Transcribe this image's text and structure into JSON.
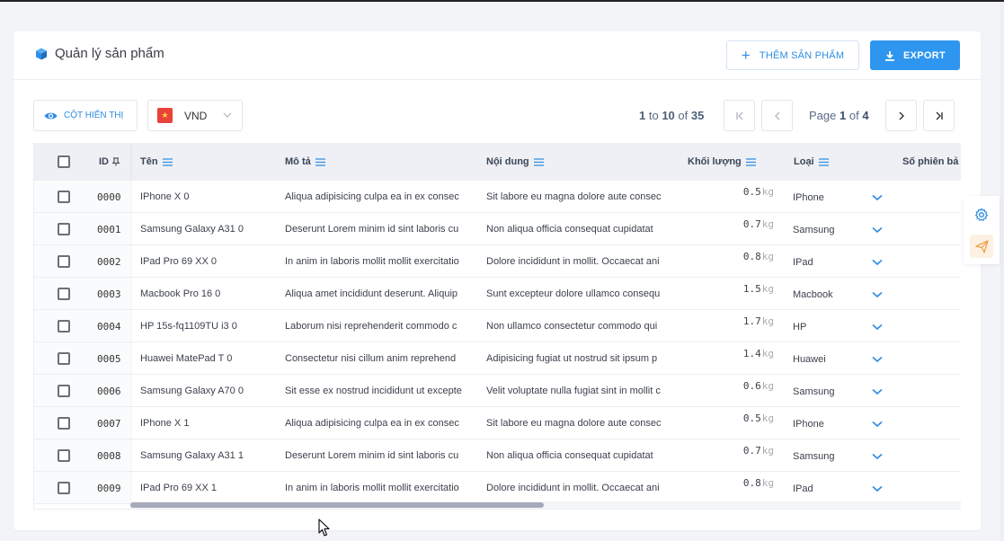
{
  "header": {
    "title": "Quản lý sản phẩm",
    "add_button": "THÊM SẢN PHẨM",
    "export_button": "EXPORT"
  },
  "toolbar": {
    "columns_button": "CỘT HIỂN THỊ",
    "currency": "VND",
    "pagination": {
      "from": "1",
      "to_word": "to",
      "to": "10",
      "of_word": "of",
      "total": "35",
      "page_word": "Page",
      "page": "1",
      "page_of_word": "of",
      "page_total": "4"
    }
  },
  "table": {
    "headers": {
      "id": "ID",
      "name": "Tên",
      "description": "Mô tả",
      "content": "Nội dung",
      "weight": "Khối lượng",
      "type": "Loại",
      "version": "Số phiên bả"
    },
    "weight_unit": "kg",
    "rows": [
      {
        "id": "0000",
        "name": "IPhone X 0",
        "description": "Aliqua adipisicing culpa ea in ex consec",
        "content": "Sit labore eu magna dolore aute consec",
        "weight": "0.5",
        "type": "IPhone"
      },
      {
        "id": "0001",
        "name": "Samsung Galaxy A31 0",
        "description": "Deserunt Lorem minim id sint laboris cu",
        "content": "Non aliqua officia consequat cupidatat",
        "weight": "0.7",
        "type": "Samsung"
      },
      {
        "id": "0002",
        "name": "IPad Pro 69 XX 0",
        "description": "In anim in laboris mollit mollit exercitatio",
        "content": "Dolore incididunt in mollit. Occaecat ani",
        "weight": "0.8",
        "type": "IPad"
      },
      {
        "id": "0003",
        "name": "Macbook Pro 16 0",
        "description": "Aliqua amet incididunt deserunt. Aliquip",
        "content": "Sunt excepteur dolore ullamco consequ",
        "weight": "1.5",
        "type": "Macbook"
      },
      {
        "id": "0004",
        "name": "HP 15s-fq1109TU i3 0",
        "description": "Laborum nisi reprehenderit commodo c",
        "content": "Non ullamco consectetur commodo qui",
        "weight": "1.7",
        "type": "HP"
      },
      {
        "id": "0005",
        "name": "Huawei MatePad T 0",
        "description": "Consectetur nisi cillum anim reprehend",
        "content": "Adipisicing fugiat ut nostrud sit ipsum p",
        "weight": "1.4",
        "type": "Huawei"
      },
      {
        "id": "0006",
        "name": "Samsung Galaxy A70 0",
        "description": "Sit esse ex nostrud incididunt ut excepte",
        "content": "Velit voluptate nulla fugiat sint in mollit c",
        "weight": "0.6",
        "type": "Samsung"
      },
      {
        "id": "0007",
        "name": "IPhone X 1",
        "description": "Aliqua adipisicing culpa ea in ex consec",
        "content": "Sit labore eu magna dolore aute consec",
        "weight": "0.5",
        "type": "IPhone"
      },
      {
        "id": "0008",
        "name": "Samsung Galaxy A31 1",
        "description": "Deserunt Lorem minim id sint laboris cu",
        "content": "Non aliqua officia consequat cupidatat",
        "weight": "0.7",
        "type": "Samsung"
      },
      {
        "id": "0009",
        "name": "IPad Pro 69 XX 1",
        "description": "In anim in laboris mollit mollit exercitatio",
        "content": "Dolore incididunt in mollit. Occaecat ani",
        "weight": "0.8",
        "type": "IPad"
      }
    ]
  },
  "colors": {
    "accent": "#2f96f0",
    "header_bg": "#eef0f5",
    "send_icon": "#f0a24a"
  },
  "icons": [
    "cube-icon",
    "plus-icon",
    "download-icon",
    "eye-icon",
    "vietnam-flag-icon",
    "chevron-down-icon",
    "first-page-icon",
    "prev-page-icon",
    "next-page-icon",
    "last-page-icon",
    "pin-icon",
    "menu-icon",
    "gear-icon",
    "send-icon",
    "mouse-cursor-icon"
  ]
}
